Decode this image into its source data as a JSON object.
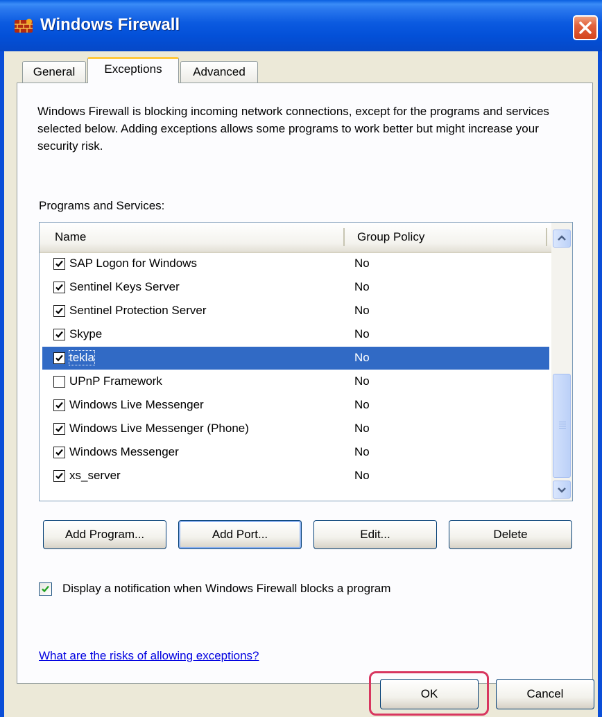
{
  "window": {
    "title": "Windows Firewall",
    "title_icon": "firewall-brick-icon",
    "close_icon": "close-icon",
    "colors": {
      "titlebar": "#0350d8",
      "close": "#d4441c",
      "selection": "#316ac5",
      "highlight": "#d8365f"
    }
  },
  "tabs": [
    {
      "label": "General"
    },
    {
      "label": "Exceptions",
      "active": true
    },
    {
      "label": "Advanced"
    }
  ],
  "description": "Windows Firewall is blocking incoming network connections, except for the programs and services selected below. Adding exceptions allows some programs to work better but might increase your security risk.",
  "programs_label": "Programs and Services:",
  "list": {
    "columns": [
      "Name",
      "Group Policy"
    ],
    "rows": [
      {
        "name": "SAP Logon for Windows",
        "group_policy": "No",
        "checked": true
      },
      {
        "name": "Sentinel Keys Server",
        "group_policy": "No",
        "checked": true
      },
      {
        "name": "Sentinel Protection Server",
        "group_policy": "No",
        "checked": true
      },
      {
        "name": "Skype",
        "group_policy": "No",
        "checked": true
      },
      {
        "name": "tekla",
        "group_policy": "No",
        "checked": true,
        "selected": true
      },
      {
        "name": "UPnP Framework",
        "group_policy": "No",
        "checked": false
      },
      {
        "name": "Windows Live Messenger",
        "group_policy": "No",
        "checked": true
      },
      {
        "name": "Windows Live Messenger (Phone)",
        "group_policy": "No",
        "checked": true
      },
      {
        "name": "Windows Messenger",
        "group_policy": "No",
        "checked": true
      },
      {
        "name": "xs_server",
        "group_policy": "No",
        "checked": true
      }
    ]
  },
  "actions": {
    "add_program": "Add Program...",
    "add_port": "Add Port...",
    "edit": "Edit...",
    "delete": "Delete"
  },
  "notify": {
    "label": "Display a notification when Windows Firewall blocks a program",
    "checked": true
  },
  "risks_link": "What are the risks of allowing exceptions?",
  "footer": {
    "ok": "OK",
    "cancel": "Cancel"
  }
}
